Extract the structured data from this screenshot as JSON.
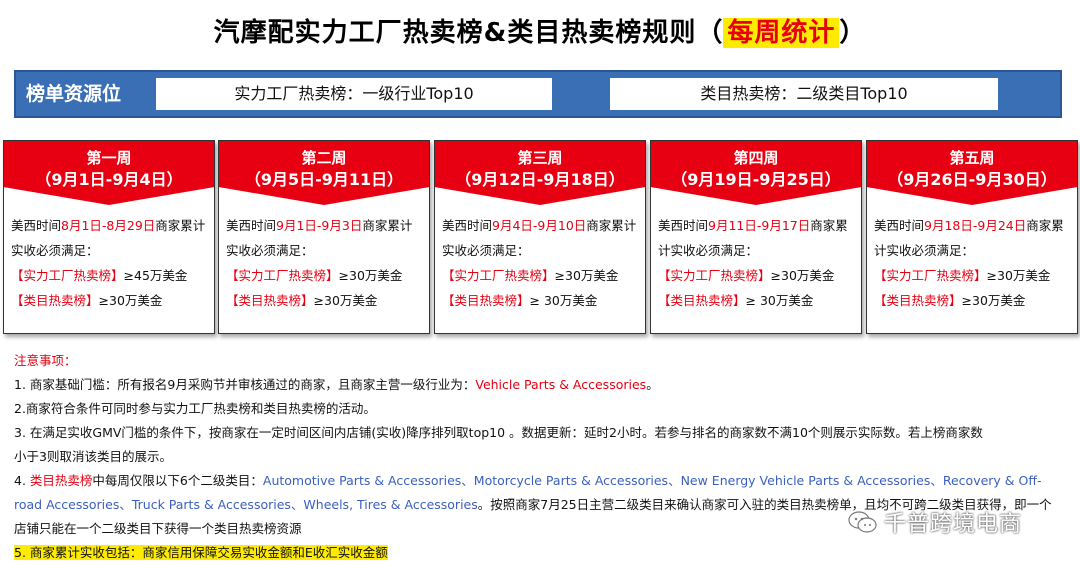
{
  "title": {
    "main": "汽摩配实力工厂热卖榜&类目热卖榜规则（",
    "highlight": "每周统计",
    "end": "）"
  },
  "resource": {
    "label": "榜单资源位",
    "box1": "实力工厂热卖榜：一级行业Top10",
    "box2": "类目热卖榜：二级类目Top10"
  },
  "weeks": [
    {
      "name": "第一周",
      "dates": "（9月1日-9月4日）",
      "prefix": "美西时间",
      "range": "8月1日-8月29日",
      "suffix": "商家累计实收必须满足：",
      "line1": "【实力工厂热卖榜】≥45万美金",
      "line2": "【类目热卖榜】≥30万美金",
      "l1tag": "【实力工厂热卖榜】",
      "l1val": "≥45万美金",
      "l2tag": "【类目热卖榜】",
      "l2val": "≥30万美金"
    },
    {
      "name": "第二周",
      "dates": "（9月5日-9月11日）",
      "prefix": "美西时间",
      "range": "9月1日-9月3日",
      "suffix": "商家累计实收必须满足：",
      "l1tag": "【实力工厂热卖榜】",
      "l1val": "≥30万美金",
      "l2tag": "【类目热卖榜】",
      "l2val": "≥30万美金"
    },
    {
      "name": "第三周",
      "dates": "（9月12日-9月18日）",
      "prefix": "美西时间",
      "range": "9月4日-9月10日",
      "suffix": "商家累计实收必须满足：",
      "l1tag": "【实力工厂热卖榜】",
      "l1val": "≥30万美金",
      "l2tag": "【类目热卖榜】",
      "l2val": "≥ 30万美金"
    },
    {
      "name": "第四周",
      "dates": "（9月19日-9月25日）",
      "prefix": "美西时间",
      "range": "9月11日-9月17日",
      "suffix": "商家累计实收必须满足：",
      "l1tag": "【实力工厂热卖榜】",
      "l1val": "≥30万美金",
      "l2tag": "【类目热卖榜】",
      "l2val": "≥ 30万美金"
    },
    {
      "name": "第五周",
      "dates": "（9月26日-9月30日）",
      "prefix": "美西时间",
      "range": "9月18日-9月24日",
      "suffix": "商家累计实收必须满足：",
      "l1tag": "【实力工厂热卖榜】",
      "l1val": "≥30万美金",
      "l2tag": "【类目热卖榜】",
      "l2val": "≥30万美金"
    }
  ],
  "notes": {
    "heading": "注意事项：",
    "n1_text": "1. 商家基础门槛：所有报名9月采购节并审核通过的商家，且商家主营一级行业为：",
    "n1_red": "Vehicle Parts & Accessories",
    "n1_end": "。",
    "n2": "2.商家符合条件可同时参与实力工厂热卖榜和类目热卖榜的活动。",
    "n3a": "3. 在满足实收GMV门槛的条件下，按商家在一定时间区间内店铺(实收)降序排列取top10 。数据更新：延时2小时。若参与排名的商家数不满10个则展示实际数。若上榜商家数",
    "n3b": "小于3则取消该类目的展示。",
    "n4_pre": "4. ",
    "n4_red": "类目热卖榜",
    "n4_mid": "中每周仅限以下6个二级类目：",
    "n4_blue": "Automotive Parts & Accessories、Motorcycle Parts & Accessories、New Energy Vehicle Parts & Accessories、Recovery & Off-road Accessories、Truck Parts & Accessories、Wheels, Tires & Accessories",
    "n4_end": "。按照商家7月25日主营二级类目来确认商家可入驻的类目热卖榜单，且均不可跨二级类目获得，即一个店铺只能在一个二级类目下获得一个类目热卖榜资源",
    "n5": "5. 商家累计实收包括：商家信用保障交易实收金额和E收汇实收金额"
  },
  "watermark": {
    "text": "千普跨境电商",
    "icon": "wechat-icon"
  }
}
